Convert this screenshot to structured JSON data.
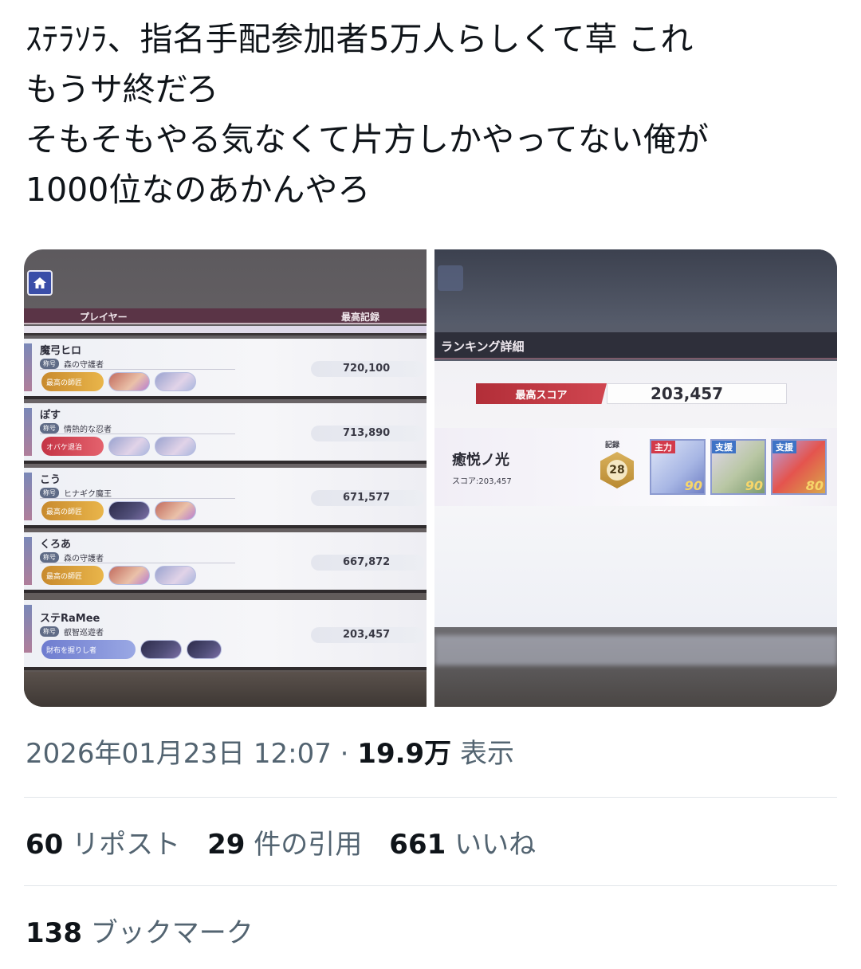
{
  "tweet": {
    "lines": [
      "ｽﾃﾗｿﾗ、指名手配参加者5万人らしくて草 これ",
      "もうサ終だろ",
      "そもそもやる気なくて片方しかやってない俺が",
      "1000位なのあかんやろ"
    ],
    "date": "2026年01月23日 12:07",
    "views_count": "19.9万",
    "views_label": "表示",
    "retweets_count": "60",
    "retweets_label": "リポスト",
    "quotes_count": "29",
    "quotes_label": "件の引用",
    "likes_count": "661",
    "likes_label": "いいね",
    "bookmarks_count": "138",
    "bookmarks_label": "ブックマーク"
  },
  "ranking": {
    "header_player": "プレイヤー",
    "header_best": "最高記録",
    "rows": [
      {
        "name": "魔弓ヒロ",
        "badge": "称号",
        "title": "森の守護者",
        "chip": "最高の師匠",
        "score": "720,100"
      },
      {
        "name": "ぽす",
        "badge": "称号",
        "title": "情熱的な忍者",
        "chip": "オバケ退治",
        "score": "713,890"
      },
      {
        "name": "こう",
        "badge": "称号",
        "title": "ヒナギク魔王",
        "chip": "最高の師匠",
        "score": "671,577"
      },
      {
        "name": "くろあ",
        "badge": "称号",
        "title": "森の守護者",
        "chip": "最高の師匠",
        "score": "667,872"
      },
      {
        "name": "ステRaMee",
        "badge": "称号",
        "title": "叡智巡遊者",
        "chip": "財布を握りし者",
        "score": "203,457"
      }
    ]
  },
  "detail": {
    "header": "ランキング詳細",
    "best_label": "最高スコア",
    "best_value": "203,457",
    "name": "癒悦ノ光",
    "score_line": "スコア:203,457",
    "record_label": "記録",
    "record_value": "28",
    "units": [
      {
        "tag": "主力",
        "lv": "90"
      },
      {
        "tag": "支援",
        "lv": "90"
      },
      {
        "tag": "支援",
        "lv": "80"
      }
    ]
  }
}
